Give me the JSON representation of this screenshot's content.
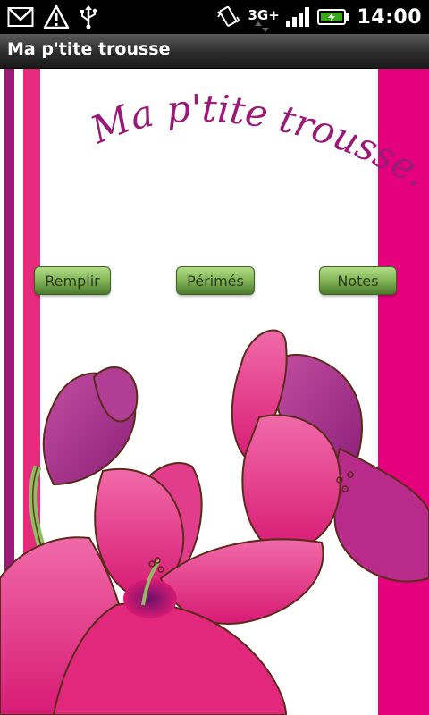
{
  "status_bar": {
    "network": "3G+",
    "time": "14:00",
    "icons": [
      "gmail-icon",
      "warning-icon",
      "usb-icon",
      "vibrate-icon",
      "signal-icon",
      "battery-icon"
    ]
  },
  "app": {
    "title": "Ma p'tite trousse"
  },
  "banner": {
    "text": "Ma p'tite trousse..."
  },
  "buttons": {
    "remplir": "Remplir",
    "perimes": "Périmés",
    "notes": "Notes"
  },
  "colors": {
    "magenta": "#e5007d",
    "pink": "#e8297c",
    "purple": "#9a1a78",
    "button_green": "#86b95a"
  }
}
